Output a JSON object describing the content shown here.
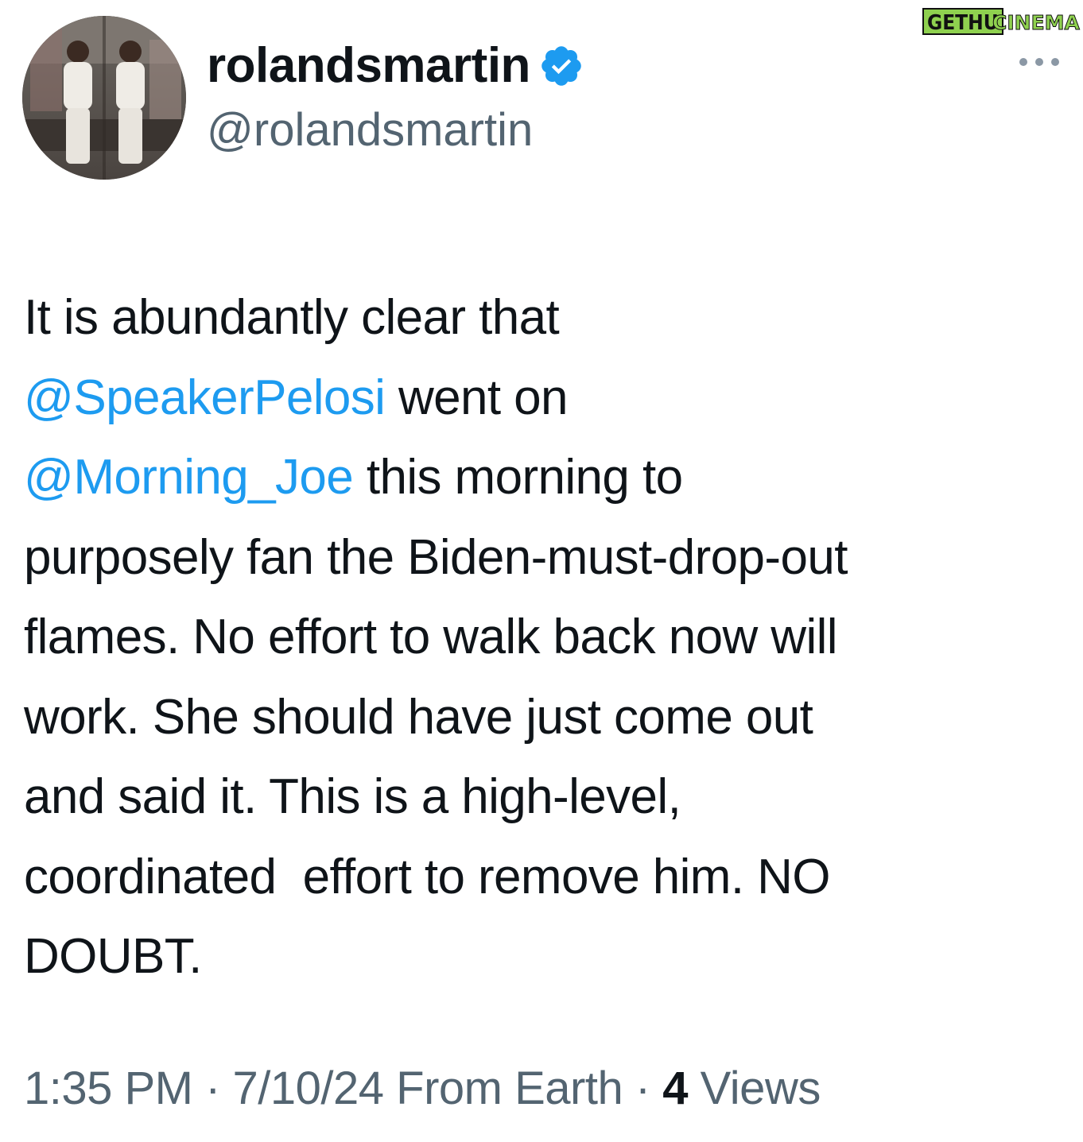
{
  "watermark": {
    "part1": "GETHU",
    "part2": "CINEMA"
  },
  "author": {
    "display_name": "rolandsmartin",
    "handle": "@rolandsmartin",
    "verified_icon": "verified-badge-icon",
    "avatar_icon": "profile-photo"
  },
  "more_icon": "more-options-icon",
  "tweet": {
    "lines": [
      [
        {
          "text": "It is abundantly clear that",
          "mention": false
        }
      ],
      [
        {
          "text": "@SpeakerPelosi",
          "mention": true
        },
        {
          "text": " went on",
          "mention": false
        }
      ],
      [
        {
          "text": "@Morning_Joe",
          "mention": true
        },
        {
          "text": " this morning to",
          "mention": false
        }
      ],
      [
        {
          "text": "purposely fan the Biden-must-drop-out",
          "mention": false
        }
      ],
      [
        {
          "text": "flames. No effort to walk back now will",
          "mention": false
        }
      ],
      [
        {
          "text": "work. She should have just come out",
          "mention": false
        }
      ],
      [
        {
          "text": "and said it. This is a high-level,",
          "mention": false
        }
      ],
      [
        {
          "text": "coordinated  effort to remove him. NO",
          "mention": false
        }
      ],
      [
        {
          "text": "DOUBT.",
          "mention": false
        }
      ]
    ]
  },
  "meta": {
    "time": "1:35 PM",
    "sep1": " · ",
    "date": "7/10/24",
    "source": " From Earth",
    "sep2": " · ",
    "views_count": "4",
    "views_label": " Views"
  },
  "colors": {
    "mention": "#1d9bf0",
    "text": "#0f1419",
    "muted": "#536471",
    "verified": "#1d9bf0"
  }
}
